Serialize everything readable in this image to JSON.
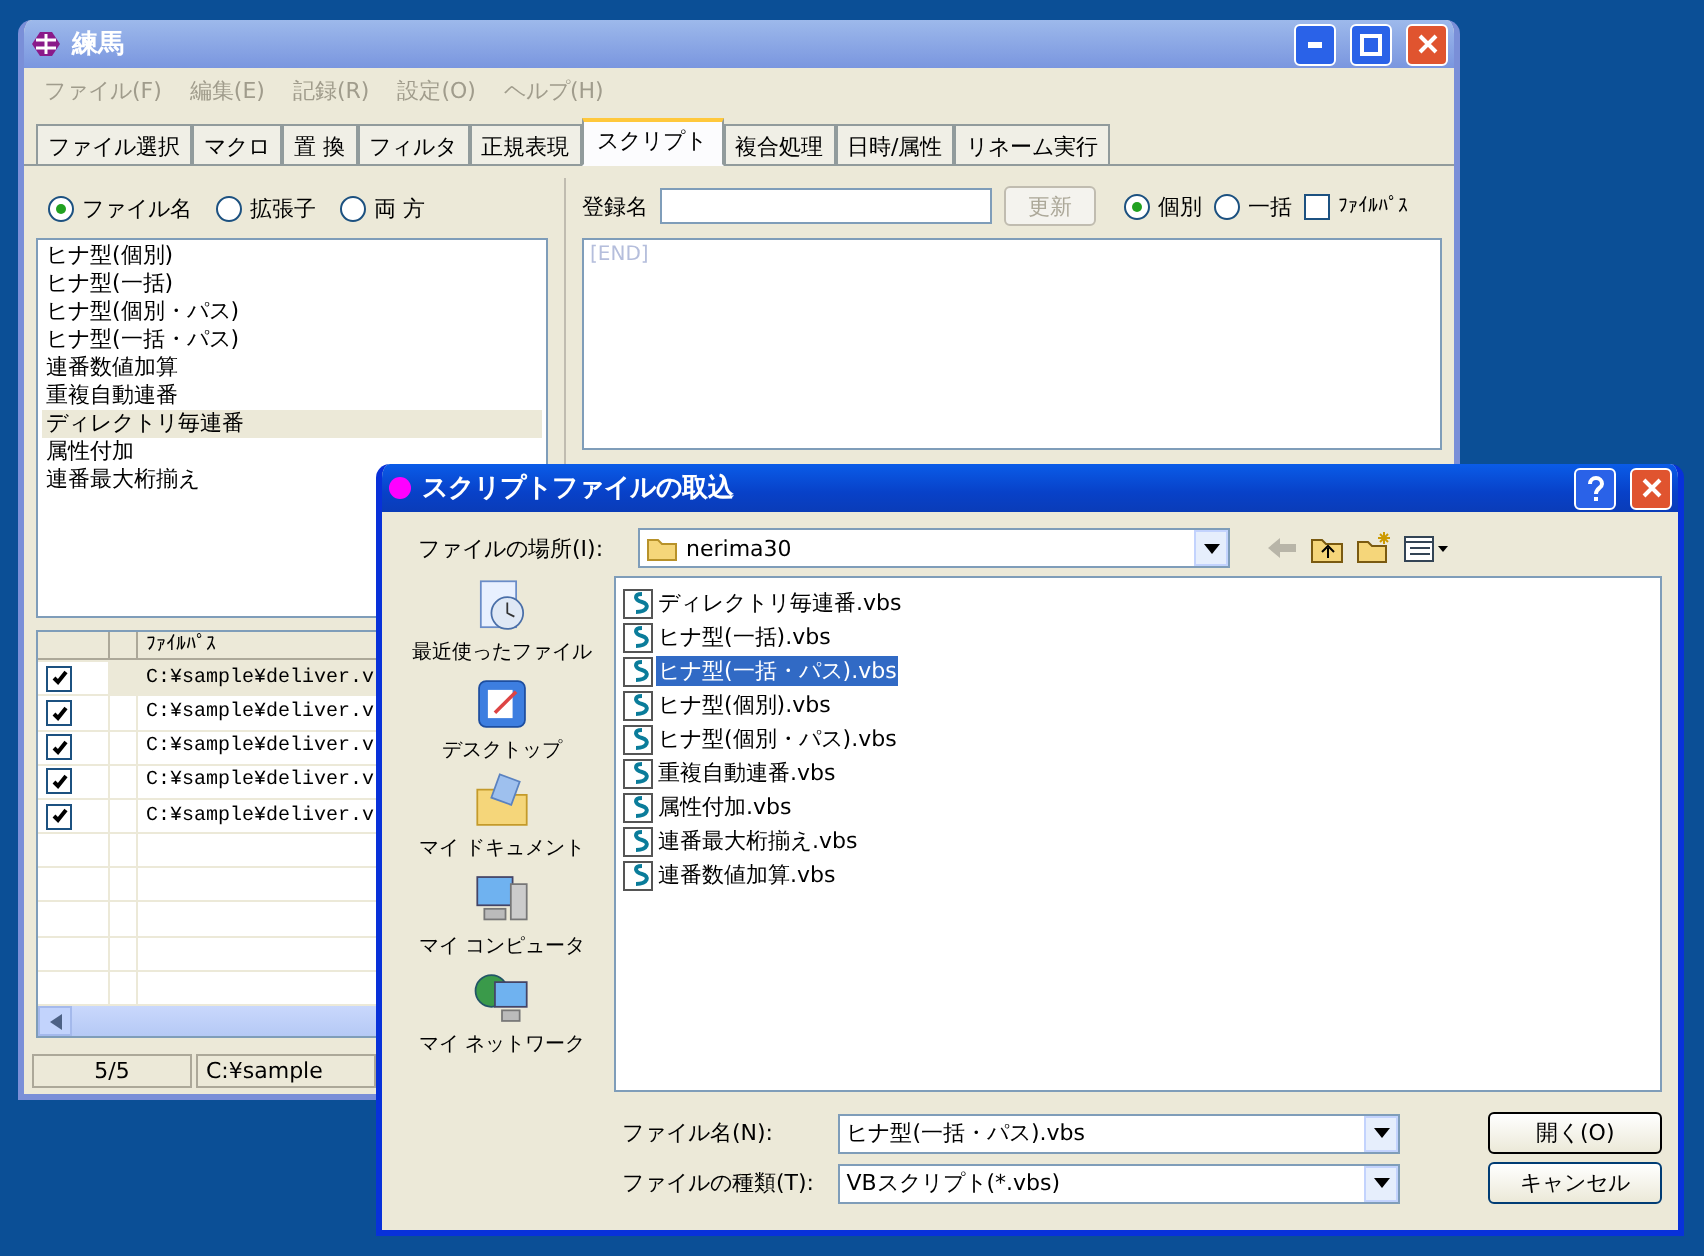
{
  "main_window": {
    "title": "練馬",
    "menu": [
      "ファイル(F)",
      "編集(E)",
      "記録(R)",
      "設定(O)",
      "ヘルプ(H)"
    ],
    "tabs": [
      {
        "label": "ファイル選択",
        "selected": false
      },
      {
        "label": "マクロ",
        "selected": false
      },
      {
        "label": "置 換",
        "selected": false
      },
      {
        "label": "フィルタ",
        "selected": false
      },
      {
        "label": "正規表現",
        "selected": false
      },
      {
        "label": "スクリプト",
        "selected": true
      },
      {
        "label": "複合処理",
        "selected": false
      },
      {
        "label": "日時/属性",
        "selected": false
      },
      {
        "label": "リネーム実行",
        "selected": false
      }
    ],
    "match_options": [
      {
        "label": "ファイル名",
        "selected": true
      },
      {
        "label": "拡張子",
        "selected": false
      },
      {
        "label": "両 方",
        "selected": false
      }
    ],
    "scripts": [
      {
        "label": "ヒナ型(個別)",
        "selected": false
      },
      {
        "label": "ヒナ型(一括)",
        "selected": false
      },
      {
        "label": "ヒナ型(個別・パス)",
        "selected": false
      },
      {
        "label": "ヒナ型(一括・パス)",
        "selected": false
      },
      {
        "label": "連番数値加算",
        "selected": false
      },
      {
        "label": "重複自動連番",
        "selected": false
      },
      {
        "label": "ディレクトリ毎連番",
        "selected": true
      },
      {
        "label": "属性付加",
        "selected": false
      },
      {
        "label": "連番最大桁揃え",
        "selected": false
      }
    ],
    "registration": {
      "label": "登録名",
      "update_button": "更新",
      "modes": [
        {
          "label": "個別",
          "selected": true
        },
        {
          "label": "一括",
          "selected": false
        }
      ],
      "file_path_option": {
        "label": "ﾌｧｲﾙﾊﾟｽ",
        "checked": false
      }
    },
    "editor_text": "[END]",
    "file_table": {
      "column_3": "ﾌｧｲﾙﾊﾟｽ",
      "rows": [
        {
          "checked": true,
          "path": "C:¥sample¥deliver.v",
          "selected": true
        },
        {
          "checked": true,
          "path": "C:¥sample¥deliver.v",
          "selected": false
        },
        {
          "checked": true,
          "path": "C:¥sample¥deliver.v",
          "selected": false
        },
        {
          "checked": true,
          "path": "C:¥sample¥deliver.v",
          "selected": false
        },
        {
          "checked": true,
          "path": "C:¥sample¥deliver.v",
          "selected": false
        }
      ]
    },
    "status_bar": [
      "5/5",
      "C:¥sample"
    ]
  },
  "dialog": {
    "title": "スクリプトファイルの取込",
    "location_label": "ファイルの場所(I):",
    "location": "nerima30",
    "places": [
      {
        "label": "最近使ったファイル",
        "kind": "recent"
      },
      {
        "label": "デスクトップ",
        "kind": "desktop"
      },
      {
        "label": "マイ ドキュメント",
        "kind": "documents"
      },
      {
        "label": "マイ コンピュータ",
        "kind": "computer"
      },
      {
        "label": "マイ ネットワーク",
        "kind": "network"
      }
    ],
    "files": [
      {
        "name": "ディレクトリ毎連番.vbs",
        "selected": false
      },
      {
        "name": "ヒナ型(一括).vbs",
        "selected": false
      },
      {
        "name": "ヒナ型(一括・パス).vbs",
        "selected": true
      },
      {
        "name": "ヒナ型(個別).vbs",
        "selected": false
      },
      {
        "name": "ヒナ型(個別・パス).vbs",
        "selected": false
      },
      {
        "name": "重複自動連番.vbs",
        "selected": false
      },
      {
        "name": "属性付加.vbs",
        "selected": false
      },
      {
        "name": "連番最大桁揃え.vbs",
        "selected": false
      },
      {
        "name": "連番数値加算.vbs",
        "selected": false
      }
    ],
    "file_name_label": "ファイル名(N):",
    "file_name": "ヒナ型(一括・パス).vbs",
    "file_type_label": "ファイルの種類(T):",
    "file_type": "VBスクリプト(*.vbs)",
    "open_button": "開く(O)",
    "cancel_button": "キャンセル"
  }
}
